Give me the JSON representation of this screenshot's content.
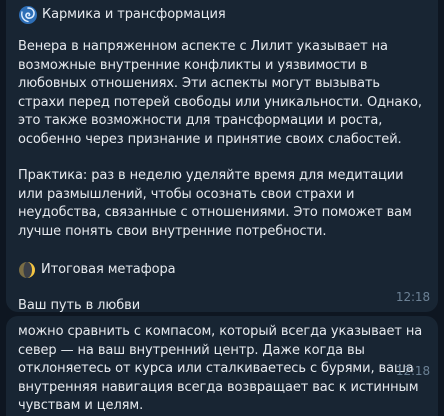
{
  "messages": [
    {
      "heading_emoji": "cyclone",
      "heading": "Кармика и трансформация",
      "paragraph_1": "Венера в напряженном аспекте с Лилит указывает на возможные внутренние конфликты и уязвимости в любовных отношениях. Эти аспекты могут вызывать страхи перед потерей свободы или уникальности. Однако, это также возможности для трансформации и роста, особенно через признание и принятие своих слабостей.",
      "paragraph_2": "Практика: раз в неделю уделяйте время для медитации или размышлений, чтобы осознать свои страхи и неудобства, связанные с отношениями. Это поможет вам лучше понять свои внутренние потребности.",
      "metaphor_emoji": "moon",
      "metaphor_heading": "Итоговая метафора",
      "closing_line": "Ваш путь в любви",
      "time": "12:18"
    },
    {
      "text": "можно сравнить с компасом, который всегда указывает на север — на ваш внутренний центр. Даже когда вы отклоняетесь от курса или сталкиваетесь с бурями, ваша внутренняя навигация всегда возвращает вас к истинным чувствам и целям.",
      "time": "12:18"
    }
  ],
  "colors": {
    "background": "#0e1621",
    "bubble": "#182533",
    "text": "#e6e9ee",
    "time": "#6b8094"
  }
}
